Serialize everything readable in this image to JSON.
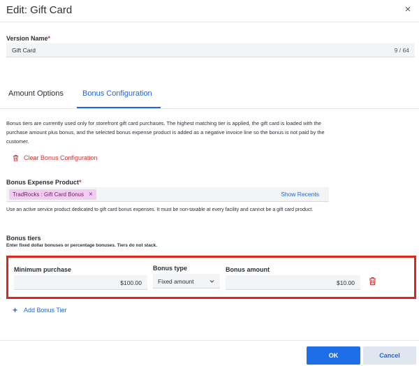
{
  "header": {
    "title": "Edit: Gift Card",
    "close_glyph": "×"
  },
  "version": {
    "label": "Version Name",
    "required_mark": "*",
    "value": "Gift Card",
    "counter": "9 / 64"
  },
  "tabs": [
    {
      "label": "Amount Options",
      "active": false
    },
    {
      "label": "Bonus Configuration",
      "active": true
    }
  ],
  "info_text": "Bonus tiers are currently used only for storefront gift card purchases. The highest matching tier is applied, the gift card is loaded with the purchase amount plus bonus, and the selected bonus expense product is added as a negative invoice line so the bonus is not paid by the customer.",
  "clear_bonus": {
    "label": "Clear Bonus Configuration",
    "icon": "trash-icon"
  },
  "bonus_product": {
    "label": "Bonus Expense Product",
    "required_mark": "*",
    "chip": "TradRocks : Gift Card Bonus",
    "chip_remove": "×",
    "show_recents": "Show Recents",
    "helper": "Use an active service product dedicated to gift card bonus expenses. It must be non-taxable at every facility and cannot be a gift card product."
  },
  "tiers": {
    "label": "Bonus tiers",
    "sublabel": "Enter fixed dollar bonuses or percentage bonuses. Tiers do not stack.",
    "columns": {
      "min": "Minimum purchase",
      "type": "Bonus type",
      "amount": "Bonus amount"
    },
    "rows": [
      {
        "min_purchase": "$100.00",
        "bonus_type": "Fixed amount",
        "bonus_amount": "$10.00"
      }
    ],
    "highlight_color": "#e0251b"
  },
  "add_tier": {
    "label": "Add Bonus Tier",
    "glyph": "+"
  },
  "footer": {
    "ok": "OK",
    "cancel": "Cancel"
  },
  "colors": {
    "accent": "#2266d8",
    "danger": "#d0312d",
    "primary_button": "#1e6ee8",
    "chip_bg": "#f1cdef"
  }
}
